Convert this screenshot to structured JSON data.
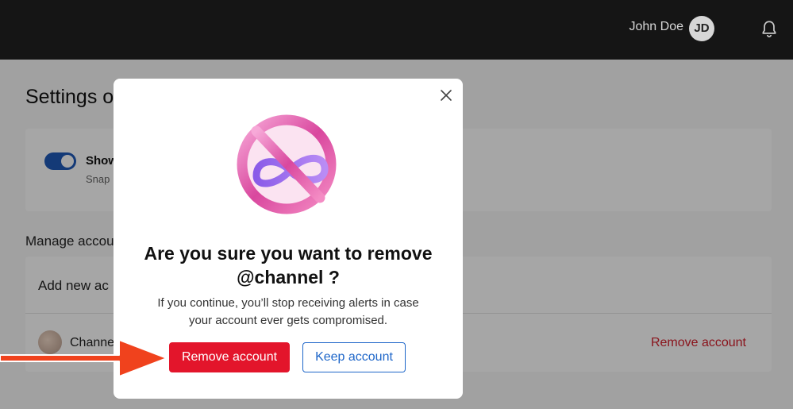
{
  "header": {
    "user_name": "John Doe",
    "avatar_initials": "JD",
    "icons": [
      "bell-icon"
    ]
  },
  "page": {
    "title": "Settings o",
    "setting": {
      "label": "Show",
      "description": "Snap"
    },
    "manage_section_title": "Manage accou",
    "add_new_label": "Add new ac",
    "account_row": {
      "name": "Channe",
      "remove_label": "Remove account"
    }
  },
  "modal": {
    "title_line1": "Are you sure you want to remove",
    "title_line2": "@channel ?",
    "body_line1": "If you continue, you’ll stop receiving alerts in case",
    "body_line2": "your account ever gets compromised.",
    "remove_button": "Remove account",
    "keep_button": "Keep account",
    "icons": [
      "close-icon",
      "prohibited-infinity-icon"
    ]
  },
  "colors": {
    "topbar": "#151515",
    "remove_red": "#e3152b",
    "keep_blue": "#1e66c9",
    "toggle_blue": "#2059b7",
    "arrow_orange": "#f0421d"
  }
}
